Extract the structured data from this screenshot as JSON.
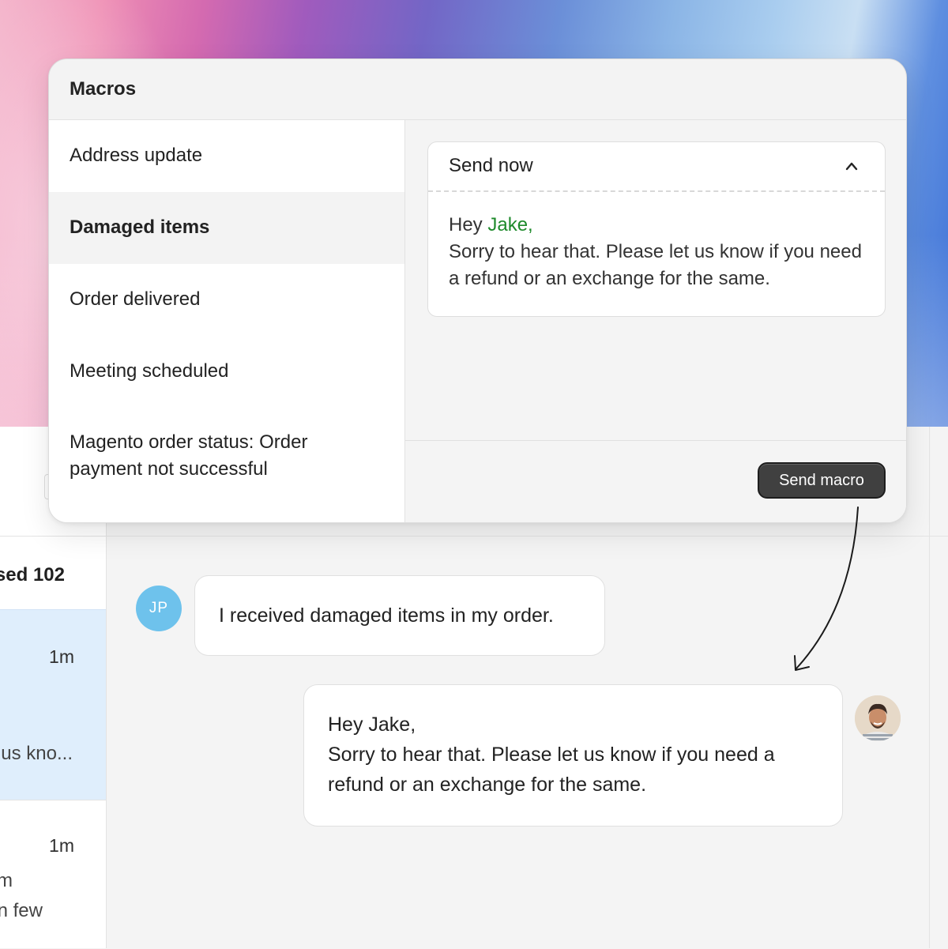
{
  "modal": {
    "title": "Macros",
    "macros": [
      {
        "label": "Address update"
      },
      {
        "label": "Damaged items"
      },
      {
        "label": "Order delivered"
      },
      {
        "label": "Meeting scheduled"
      },
      {
        "label": "Magento order status: Order payment not successful"
      }
    ],
    "selected_macro": "Damaged items",
    "preview": {
      "mode_label": "Send now",
      "greeting": "Hey ",
      "variable": "Jake,",
      "body": "Sorry to hear that. Please let us know if you need a refund or an exchange for the same."
    },
    "send_button": "Send macro"
  },
  "list": {
    "header_fragment": "sed 102",
    "items": [
      {
        "time": "1m",
        "line": "us kno..."
      },
      {
        "time": "1m",
        "line_1": "m",
        "line_2": "n few"
      }
    ]
  },
  "chat": {
    "customer_initials": "JP",
    "customer_message": "I received damaged items in my order.",
    "agent_message_greeting": "Hey Jake,",
    "agent_message_body": "Sorry to hear that. Please let us know if you need a refund or an exchange for the same."
  },
  "colors": {
    "variable_green": "#1e8a2b",
    "selected_row_blue": "#dfeefc",
    "avatar_blue": "#6ec2ec",
    "button_dark": "#404040"
  }
}
